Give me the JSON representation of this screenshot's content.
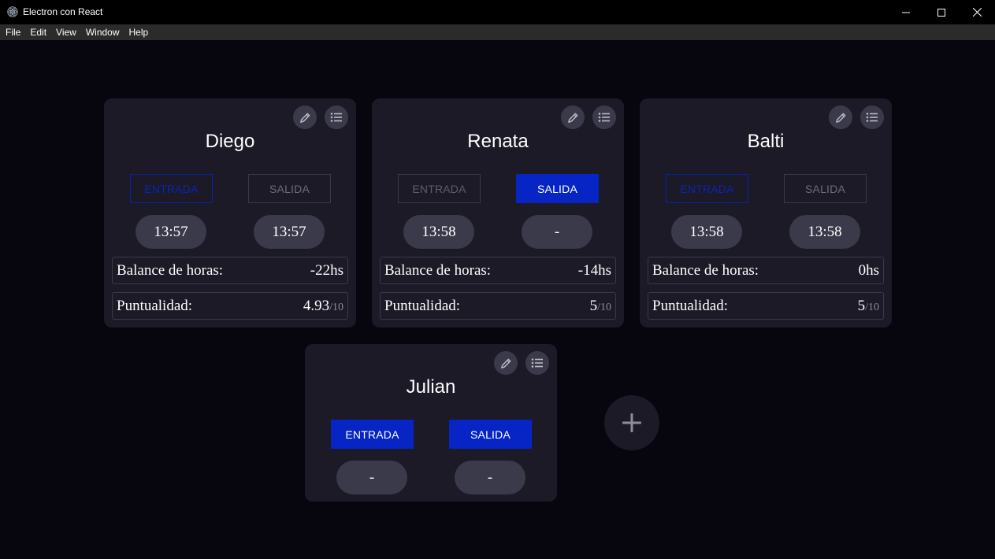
{
  "window": {
    "title": "Electron con React"
  },
  "menu": [
    "File",
    "Edit",
    "View",
    "Window",
    "Help"
  ],
  "labels": {
    "balance": "Balance de horas:",
    "punctuality": "Puntualidad:",
    "entrada": "ENTRADA",
    "salida": "SALIDA",
    "out_of": "/10"
  },
  "cards": [
    {
      "name": "Diego",
      "entrada_state": "outline-blue",
      "salida_state": "outline-gray",
      "entrada_time": "13:57",
      "salida_time": "13:57",
      "balance": "-22hs",
      "punctuality": "4.93"
    },
    {
      "name": "Renata",
      "entrada_state": "dim",
      "salida_state": "filled",
      "entrada_time": "13:58",
      "salida_time": "-",
      "balance": "-14hs",
      "punctuality": "5"
    },
    {
      "name": "Balti",
      "entrada_state": "outline-blue",
      "salida_state": "outline-gray",
      "entrada_time": "13:58",
      "salida_time": "13:58",
      "balance": "0hs",
      "punctuality": "5"
    },
    {
      "name": "Julian",
      "entrada_state": "filled",
      "salida_state": "filled",
      "entrada_time": "-",
      "salida_time": "-"
    }
  ],
  "colors": {
    "background": "#07060e",
    "card": "#1b1a26",
    "pill": "#3b3a4b",
    "accent": "#0625c4"
  },
  "icons": {
    "app": "electron-icon",
    "edit": "pencil-icon",
    "history": "list-icon",
    "add": "plus-icon"
  }
}
